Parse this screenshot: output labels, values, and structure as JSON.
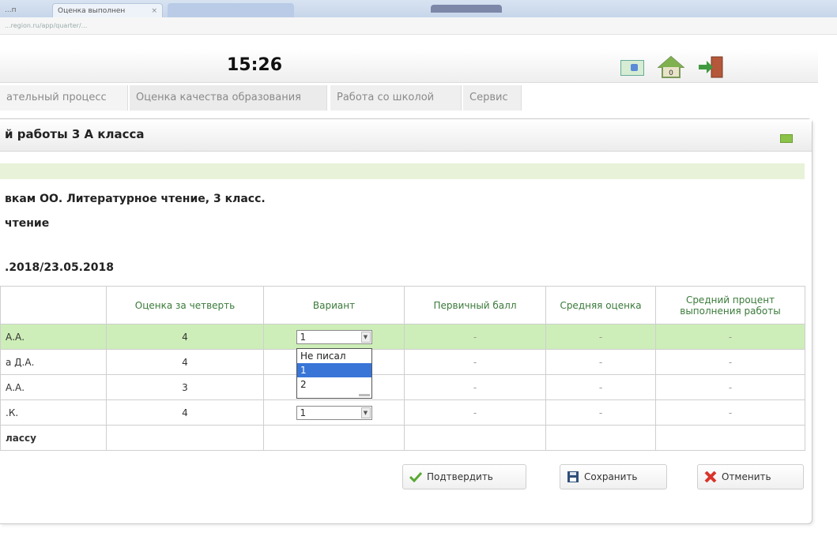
{
  "browser": {
    "tabs": [
      {
        "label": "...п"
      },
      {
        "label": "Оценка выполнен",
        "close": "×"
      },
      {
        "label": ""
      }
    ],
    "address": "...region.ru/app/quarter/..."
  },
  "header": {
    "time": "15:26"
  },
  "menu": {
    "items": [
      "ательный процесс",
      "Оценка качества образования",
      "Работа со школой",
      "Сервис"
    ]
  },
  "panel": {
    "title": "й работы 3 А класса",
    "line1": "вкам ОО. Литературное чтение, 3 класс.",
    "line2": "чтение",
    "line3": ".2018/23.05.2018"
  },
  "table": {
    "headers": [
      "",
      "Оценка за четверть",
      "Вариант",
      "Первичный балл",
      "Средняя оценка",
      "Средний процент выполнения работы"
    ],
    "rows": [
      {
        "name": "А.А.",
        "grade": "4",
        "variant": "1",
        "score": "-",
        "avg": "-",
        "pct": "-"
      },
      {
        "name": "а Д.А.",
        "grade": "4",
        "variant": "",
        "score": "-",
        "avg": "-",
        "pct": "-"
      },
      {
        "name": "А.А.",
        "grade": "3",
        "variant": "",
        "score": "-",
        "avg": "-",
        "pct": "-"
      },
      {
        "name": ".К.",
        "grade": "4",
        "variant": "1",
        "score": "-",
        "avg": "-",
        "pct": "-"
      },
      {
        "name": "лассу",
        "grade": "",
        "variant": "",
        "score": "",
        "avg": "",
        "pct": ""
      }
    ]
  },
  "dropdown": {
    "options": [
      "Не писал",
      "1",
      "2"
    ],
    "selected_index": 1
  },
  "buttons": {
    "confirm": "Подтвердить",
    "save": "Сохранить",
    "cancel": "Отменить"
  },
  "colors": {
    "highlight_row": "#cdeeb8",
    "header_text": "#3a7a3a",
    "selection": "#3875d7"
  }
}
